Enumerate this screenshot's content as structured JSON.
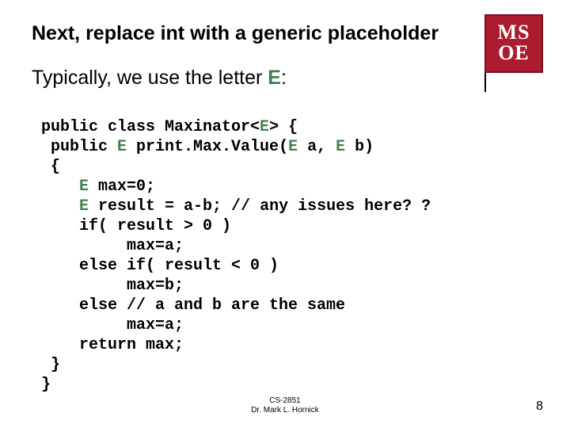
{
  "title": "Next, replace int with a generic placeholder",
  "subtitle_pre": "Typically, we use the letter ",
  "subtitle_letter": "E",
  "subtitle_post": ":",
  "logo_line1": "MS",
  "logo_line2": "OE",
  "code": {
    "l1a": "public class Maxinator<",
    "l1b": "E",
    "l1c": "> {",
    "l2a": " public ",
    "l2b": "E",
    "l2c": " print.Max.Value(",
    "l2d": "E",
    "l2e": " a, ",
    "l2f": "E",
    "l2g": " b)",
    "l3": " {",
    "l4a": "    ",
    "l4b": "E",
    "l4c": " max=0;",
    "l5a": "    ",
    "l5b": "E",
    "l5c": " result = a-b; // any issues here? ?",
    "l6": "    if( result > 0 )",
    "l7": "         max=a;",
    "l8": "    else if( result < 0 )",
    "l9": "         max=b;",
    "l10": "    else // a and b are the same",
    "l11": "         max=a;",
    "l12": "    return max;",
    "l13": " }",
    "l14": "}"
  },
  "footer_line1": "CS-2851",
  "footer_line2": "Dr. Mark L. Hornick",
  "page_number": "8"
}
